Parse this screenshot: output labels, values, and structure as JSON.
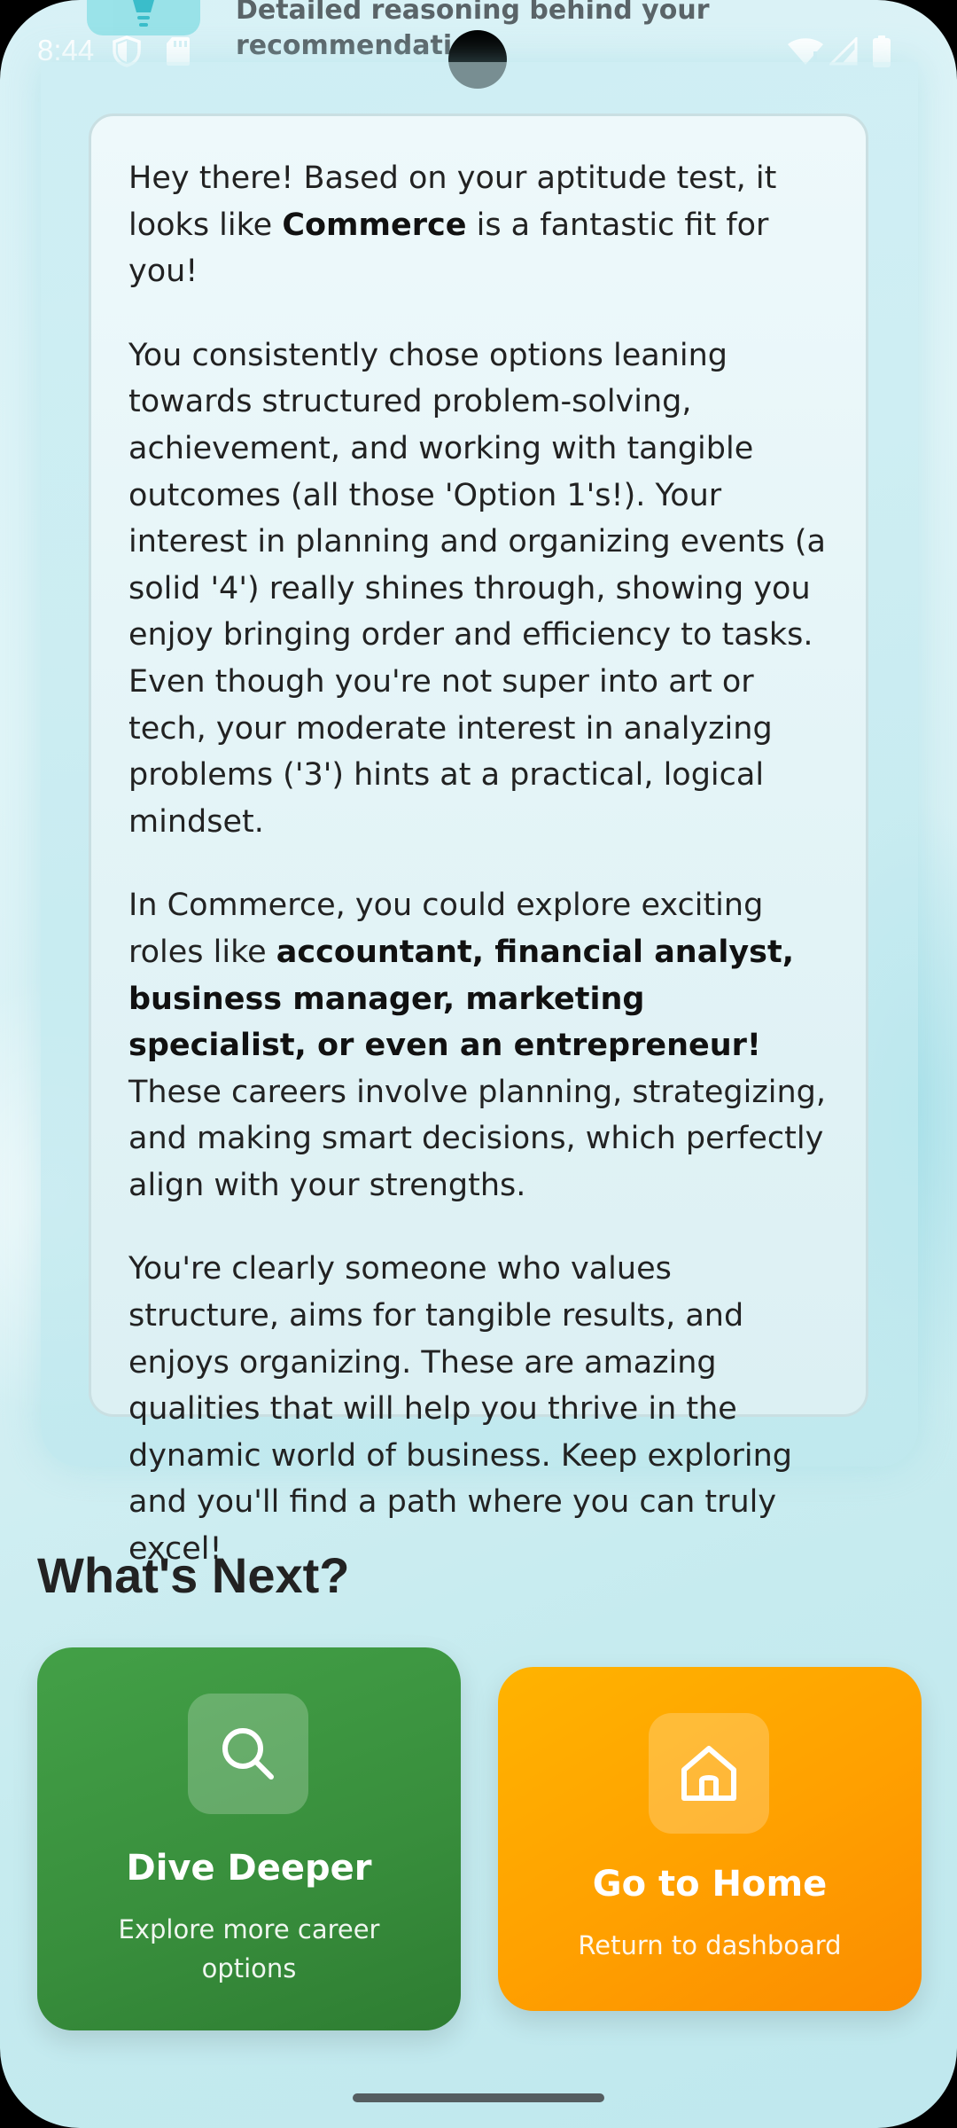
{
  "status_bar": {
    "time": "8:44",
    "icons": [
      "shield-icon",
      "sd-card-icon",
      "wifi-icon",
      "signal-icon",
      "battery-icon"
    ]
  },
  "header": {
    "icon": "lightbulb-icon",
    "subtitle": "Detailed reasoning behind your recommendation"
  },
  "reasoning": {
    "p1_before": "Hey there! Based on your aptitude test, it looks like ",
    "p1_bold": "Commerce",
    "p1_after": " is a fantastic fit for you!",
    "p2": "You consistently chose options leaning towards structured problem-solving, achievement, and working with tangible outcomes (all those 'Option 1's!). Your interest in planning and organizing events (a solid '4') really shines through, showing you enjoy bringing order and efficiency to tasks. Even though you're not super into art or tech, your moderate interest in analyzing problems ('3') hints at a practical, logical mindset.",
    "p3_before": "In Commerce, you could explore exciting roles like ",
    "p3_bold": "accountant, financial analyst, business manager, marketing specialist, or even an entrepreneur!",
    "p3_after": " These careers involve planning, strategizing, and making smart decisions, which perfectly align with your strengths.",
    "p4": "You're clearly someone who values structure, aims for tangible results, and enjoys organizing. These are amazing qualities that will help you thrive in the dynamic world of business. Keep exploring and you'll find a path where you can truly excel!"
  },
  "next_section": {
    "title": "What's Next?",
    "cards": [
      {
        "title": "Dive Deeper",
        "subtitle": "Explore more career options",
        "icon": "search-icon",
        "color": "#388e3c"
      },
      {
        "title": "Go to Home",
        "subtitle": "Return to dashboard",
        "icon": "home-icon",
        "color": "#ffa000"
      }
    ]
  }
}
